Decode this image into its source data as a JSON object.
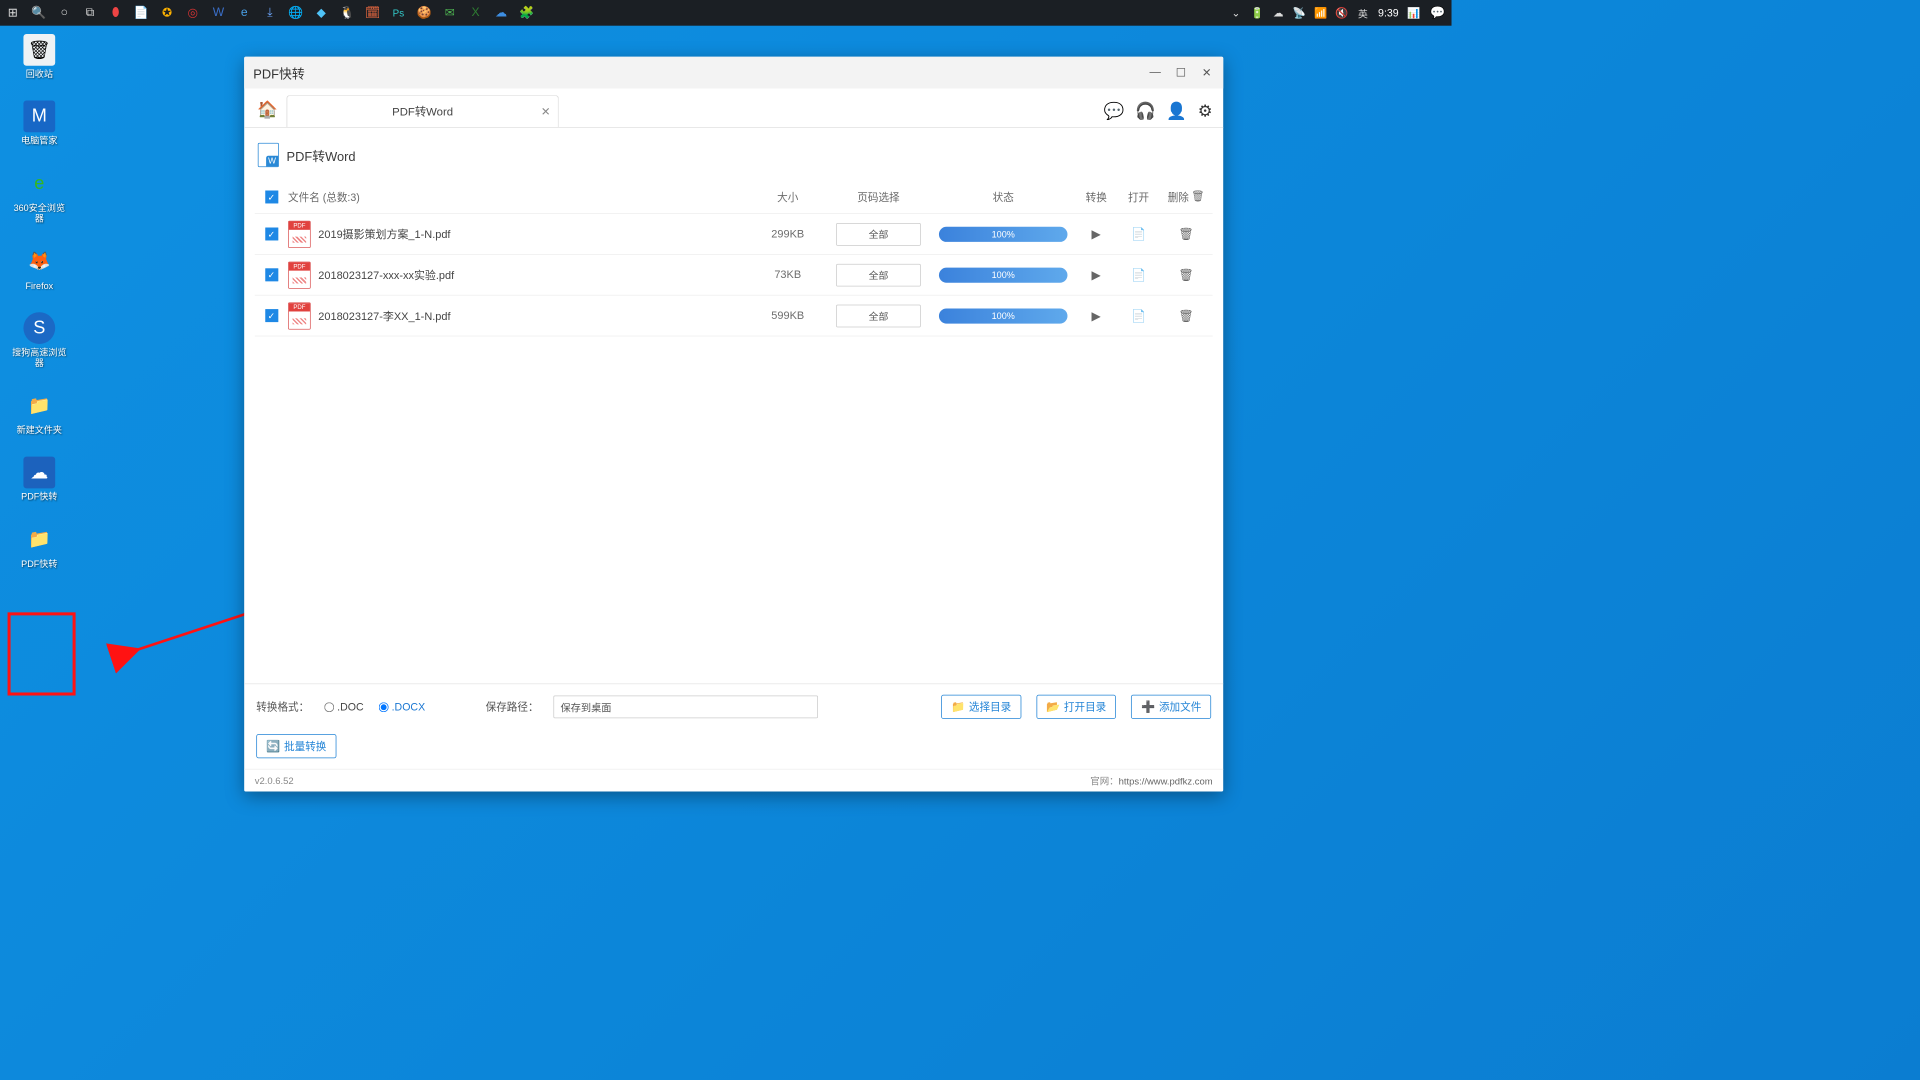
{
  "taskbar": {
    "time": "9:39",
    "ime": "英"
  },
  "desktop_icons": [
    {
      "label": "回收站",
      "color": "#dfe6ea",
      "emoji": "🗑"
    },
    {
      "label": "电脑管家",
      "color": "#1565c0",
      "emoji": "M"
    },
    {
      "label": "360安全浏览器",
      "color": "#2fa61b",
      "emoji": "e"
    },
    {
      "label": "Firefox",
      "color": "#ff7a1a",
      "emoji": "🦊"
    },
    {
      "label": "搜狗高速浏览器",
      "color": "#1565c0",
      "emoji": "S"
    },
    {
      "label": "新建文件夹",
      "color": "#ffd66b",
      "emoji": "📁"
    },
    {
      "label": "PDF快转",
      "color": "#1e5fb3",
      "emoji": "☁"
    },
    {
      "label": "PDF快转",
      "color": "#ffd66b",
      "emoji": "📁"
    }
  ],
  "app": {
    "title": "PDF快转",
    "tab_label": "PDF转Word",
    "section_title": "PDF转Word"
  },
  "headers": {
    "filename": "文件名 (总数:3)",
    "size": "大小",
    "pages": "页码选择",
    "status": "状态",
    "convert": "转换",
    "open": "打开",
    "delete": "删除"
  },
  "rows": [
    {
      "name": "2019摄影策划方案_1-N.pdf",
      "size": "299KB",
      "pages": "全部",
      "progress": "100%"
    },
    {
      "name": "2018023127-xxx-xx实验.pdf",
      "size": "73KB",
      "pages": "全部",
      "progress": "100%"
    },
    {
      "name": "2018023127-李XX_1-N.pdf",
      "size": "599KB",
      "pages": "全部",
      "progress": "100%"
    }
  ],
  "footer": {
    "fmt_label": "转换格式：",
    "fmt_doc": ".DOC",
    "fmt_docx": ".DOCX",
    "path_label": "保存路径：",
    "path_value": "保存到桌面",
    "btn_choose": "选择目录",
    "btn_open": "打开目录",
    "btn_add": "添加文件",
    "btn_batch": "批量转换",
    "version": "v2.0.6.52",
    "site_label": "官网：",
    "site": "https://www.pdfkz.com"
  }
}
